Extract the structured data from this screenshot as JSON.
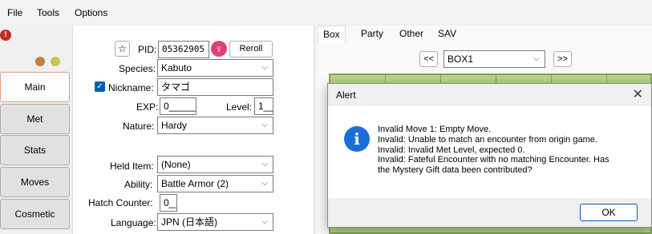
{
  "menu": [
    "File",
    "Tools",
    "Options"
  ],
  "nav_tabs": [
    "Main",
    "Met",
    "Stats",
    "Moves",
    "Cosmetic"
  ],
  "form": {
    "pid_label": "PID:",
    "pid_value": "05362905",
    "reroll_label": "Reroll",
    "star_glyph": "☆",
    "gender_glyph": "♀",
    "species_label": "Species:",
    "species_value": "Kabuto",
    "nickname_label": "Nickname:",
    "nickname_value": "タマゴ",
    "nickname_checked_glyph": "✓",
    "exp_label": "EXP:",
    "exp_value": "0_____",
    "level_label": "Level:",
    "level_value": "1__",
    "nature_label": "Nature:",
    "nature_value": "Hardy",
    "held_item_label": "Held Item:",
    "held_item_value": "(None)",
    "ability_label": "Ability:",
    "ability_value": "Battle Armor (2)",
    "hatch_label": "Hatch Counter:",
    "hatch_value": "0__",
    "language_label": "Language:",
    "language_value": "JPN (日本語)"
  },
  "box_tabs": [
    "Box",
    "Party",
    "Other",
    "SAV"
  ],
  "box": {
    "prev_label": "<<",
    "next_label": ">>",
    "selected": "BOX1"
  },
  "alert": {
    "title": "Alert",
    "close_glyph": "✕",
    "info_glyph": "i",
    "lines": [
      "Invalid Move 1: Empty Move.",
      "Invalid: Unable to match an encounter from origin game.",
      "Invalid: Invalid Met Level, expected 0.",
      "Invalid: Fateful Encounter with no matching Encounter. Has",
      "the Mystery Gift data been contributed?"
    ],
    "ok_label": "OK"
  },
  "icons": {
    "warning": "!",
    "dropdown": "⌵"
  },
  "colors": {
    "accent": "#005fb8",
    "warning": "#c42b1c",
    "female": "#e0407a",
    "box_grid": "#b5d58a"
  }
}
